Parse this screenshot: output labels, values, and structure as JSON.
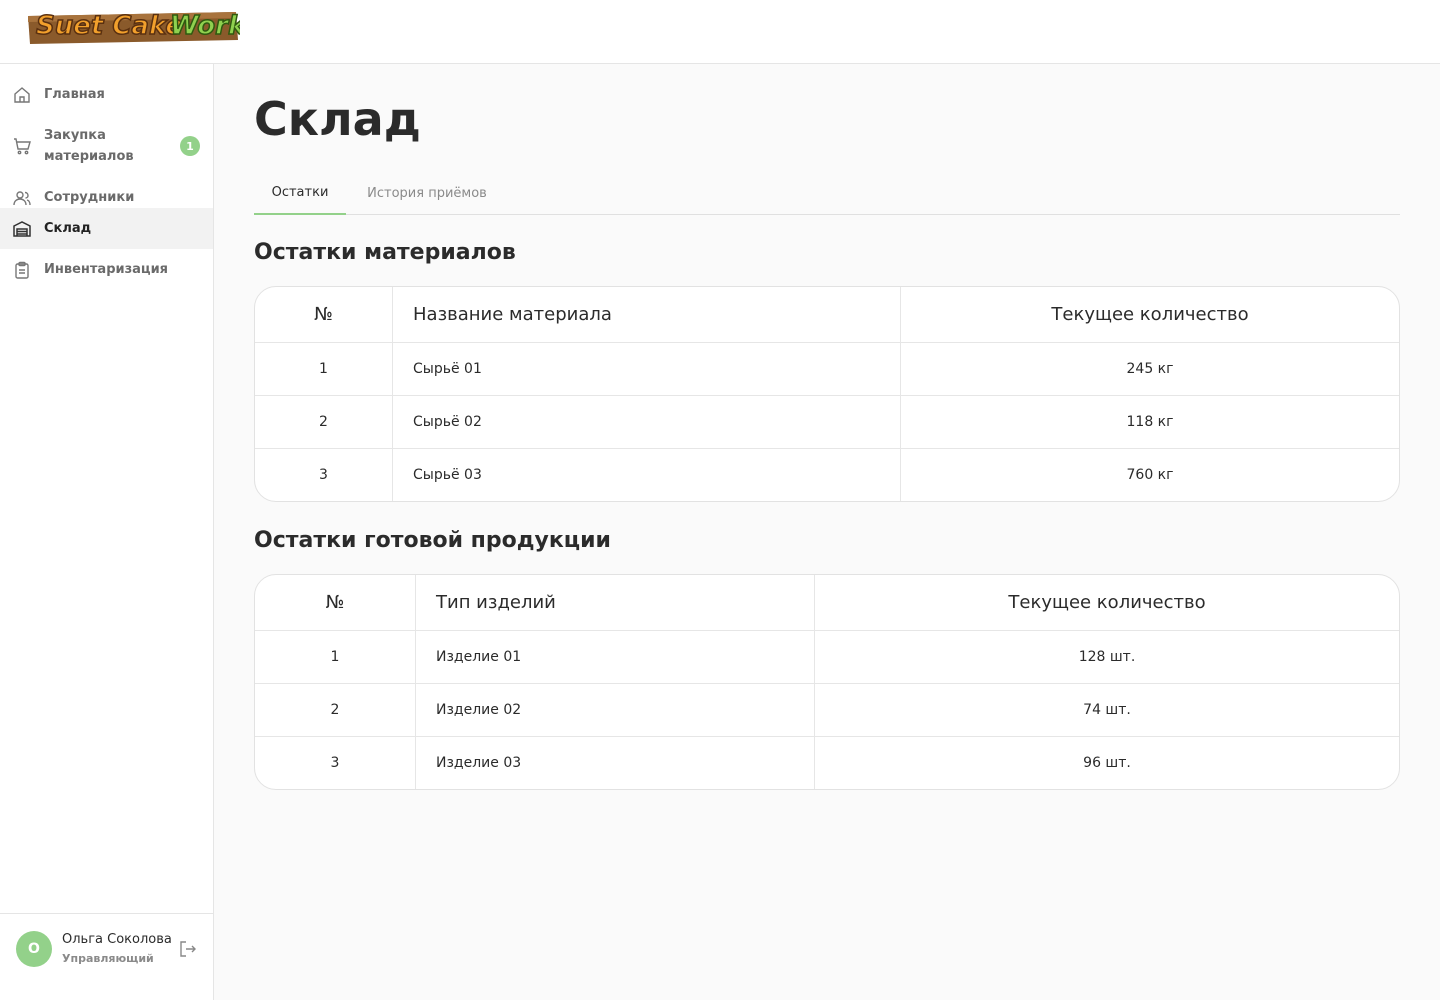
{
  "brand": {
    "logo_text_1": "Suet Cake",
    "logo_text_2": "Work"
  },
  "sidebar": {
    "items": [
      {
        "label": "Главная",
        "icon": "home-icon"
      },
      {
        "label": "Закупка материалов",
        "icon": "cart-icon",
        "badge": "1"
      },
      {
        "label": "Сотрудники",
        "icon": "users-icon"
      },
      {
        "label": "Склад",
        "icon": "warehouse-icon",
        "active": true
      },
      {
        "label": "Инвентаризация",
        "icon": "clipboard-icon"
      }
    ],
    "user": {
      "initial": "О",
      "name": "Ольга Соколова",
      "role": "Управляющий"
    }
  },
  "page": {
    "title": "Склад",
    "tabs": [
      {
        "label": "Остатки",
        "active": true
      },
      {
        "label": "История приёмов"
      }
    ]
  },
  "materials": {
    "title": "Остатки материалов",
    "headers": [
      "№",
      "Название материала",
      "Текущее количество"
    ],
    "rows": [
      [
        "1",
        "Сырьё 01",
        "245 кг"
      ],
      [
        "2",
        "Сырьё 02",
        "118 кг"
      ],
      [
        "3",
        "Сырьё 03",
        "760 кг"
      ]
    ]
  },
  "products": {
    "title": "Остатки готовой продукции",
    "headers": [
      "№",
      "Тип изделий",
      "Текущее количество"
    ],
    "rows": [
      [
        "1",
        "Изделие 01",
        "128 шт."
      ],
      [
        "2",
        "Изделие 02",
        "74 шт."
      ],
      [
        "3",
        "Изделие 03",
        "96 шт."
      ]
    ]
  },
  "colors": {
    "accent": "#93d18a",
    "logo_orange": "#f2a02c",
    "logo_green": "#8fd14f",
    "logo_wood": "#8a5a2b"
  }
}
